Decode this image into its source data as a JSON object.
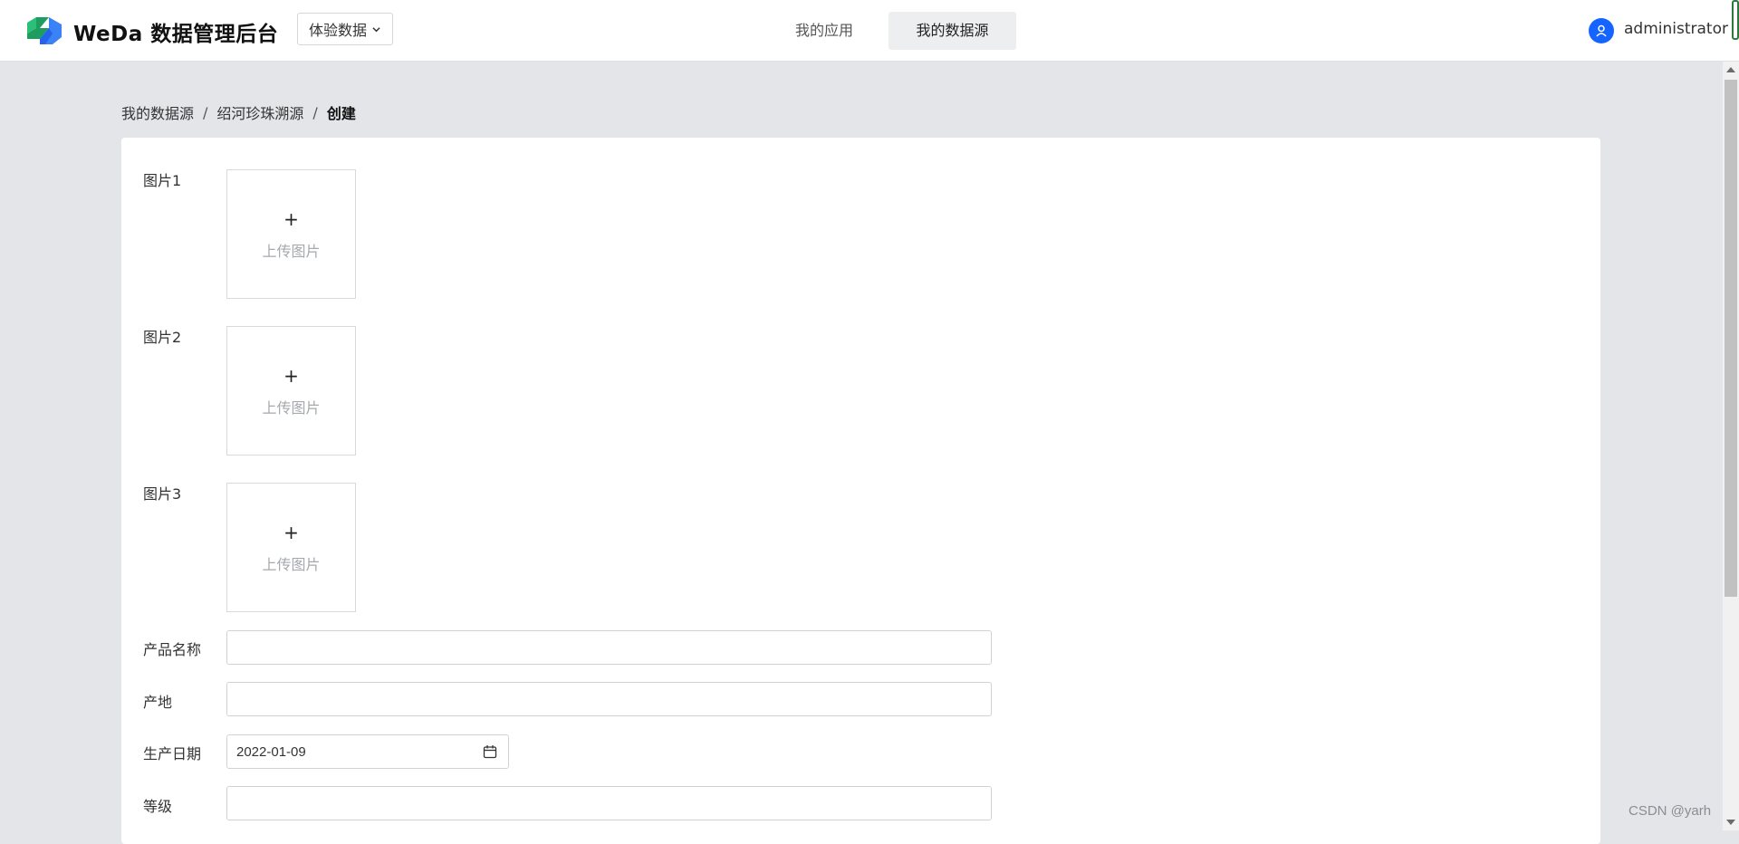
{
  "header": {
    "brand_title": "WeDa 数据管理后台",
    "env_select_value": "体验数据",
    "tabs": [
      {
        "label": "我的应用",
        "active": false
      },
      {
        "label": "我的数据源",
        "active": true
      }
    ],
    "user_name": "administrator",
    "accent_color": "#1664ff"
  },
  "breadcrumb": {
    "items": [
      "我的数据源",
      "绍河珍珠溯源",
      "创建"
    ],
    "separator": "/"
  },
  "form": {
    "images": [
      {
        "label": "图片1",
        "upload_text": "上传图片",
        "plus": "+"
      },
      {
        "label": "图片2",
        "upload_text": "上传图片",
        "plus": "+"
      },
      {
        "label": "图片3",
        "upload_text": "上传图片",
        "plus": "+"
      }
    ],
    "product_name": {
      "label": "产品名称",
      "value": ""
    },
    "origin": {
      "label": "产地",
      "value": ""
    },
    "production_date": {
      "label": "生产日期",
      "value": "2022-01-09"
    },
    "grade": {
      "label": "等级",
      "value": ""
    }
  },
  "watermark": "CSDN @yarh"
}
